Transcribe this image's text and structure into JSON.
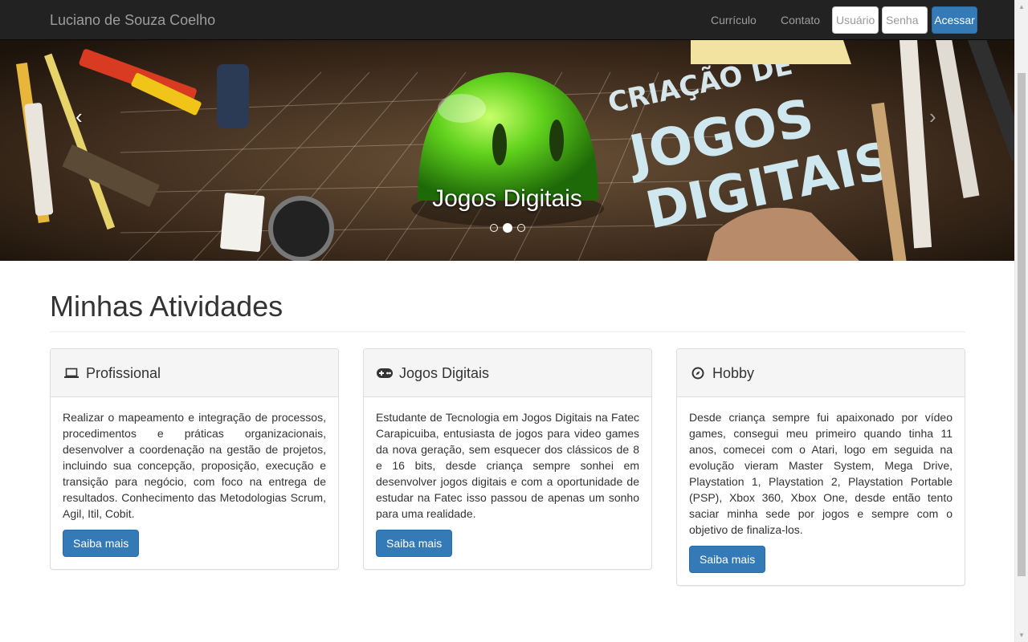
{
  "navbar": {
    "brand": "Luciano de Souza Coelho",
    "links": [
      "Currículo",
      "Contato"
    ],
    "username_placeholder": "Usuário",
    "password_placeholder": "Senha",
    "login_button": "Acessar"
  },
  "carousel": {
    "caption": "Jogos Digitais",
    "prev_glyph": "‹",
    "next_glyph": "›",
    "indicators_count": 3,
    "active_index": 1,
    "banner_text_top": "CRIAÇÃO DE",
    "banner_text_big1": "JOGOS",
    "banner_text_big2": "DIGITAIS"
  },
  "section": {
    "title": "Minhas Atividades"
  },
  "panels": [
    {
      "title": "Profissional",
      "icon": "laptop-icon",
      "text": "Realizar o mapeamento e integração de processos, procedimentos e práticas organizacionais, desenvolver a coordenação na gestão de projetos, incluindo sua concepção, proposição, execução e transição para negócio, com foco na entrega de resultados. Conhecimento das Metodologias Scrum, Agil, Itil, Cobit.",
      "button": "Saiba mais"
    },
    {
      "title": "Jogos Digitais",
      "icon": "gamepad-icon",
      "text": "Estudante de Tecnologia em Jogos Digitais na Fatec Carapicuiba, entusiasta de jogos para video games da nova geração, sem esquecer dos clássicos de 8 e 16 bits, desde criança sempre sonhei em desenvolver jogos digitais e com a oportunidade de estudar na Fatec isso passou de apenas um sonho para uma realidade.",
      "button": "Saiba mais"
    },
    {
      "title": "Hobby",
      "icon": "compass-icon",
      "text": "Desde criança sempre fui apaixonado por vídeo games, consegui meu primeiro quando tinha 11 anos, comecei com o Atari, logo em seguida na evolução vieram Master System, Mega Drive, Playstation 1, Playstation 2, Playstation Portable (PSP), Xbox 360, Xbox One, desde então tento saciar minha sede por jogos e sempre com o objetivo de finaliza-los.",
      "button": "Saiba mais"
    }
  ],
  "colors": {
    "navbar_bg": "#222222",
    "navbar_text": "#9d9d9d",
    "primary": "#337ab7",
    "panel_heading_bg": "#f5f5f5",
    "panel_border": "#dddddd"
  }
}
